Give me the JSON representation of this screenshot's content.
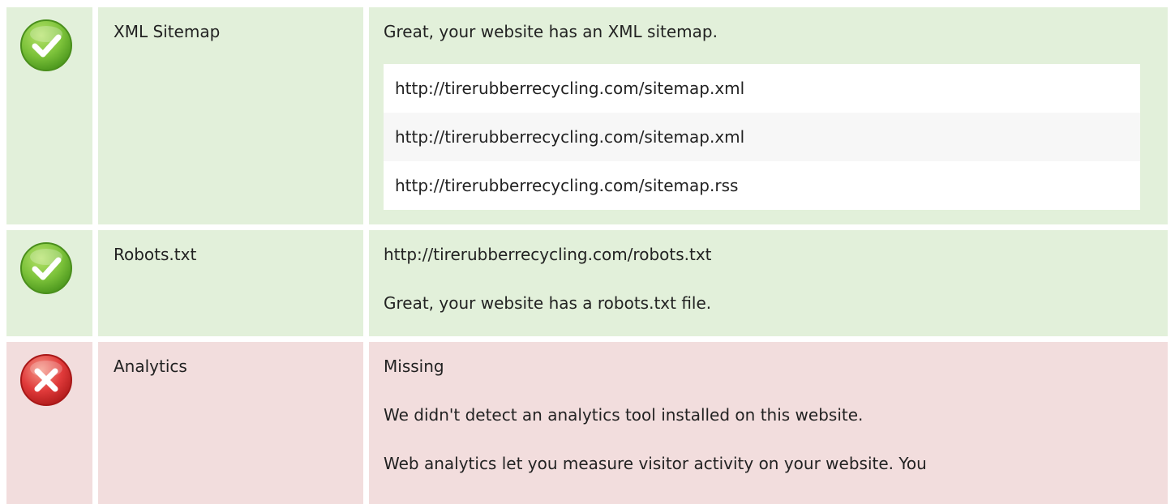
{
  "rows": [
    {
      "status": "pass",
      "name": "XML Sitemap",
      "desc": "Great, your website has an XML sitemap.",
      "urls": [
        "http://tirerubberrecycling.com/sitemap.xml",
        "http://tirerubberrecycling.com/sitemap.xml",
        "http://tirerubberrecycling.com/sitemap.rss"
      ]
    },
    {
      "status": "pass",
      "name": "Robots.txt",
      "line1": "http://tirerubberrecycling.com/robots.txt",
      "line2": "Great, your website has a robots.txt file."
    },
    {
      "status": "fail",
      "name": "Analytics",
      "line1": "Missing",
      "line2": "We didn't detect an analytics tool installed on this website.",
      "line3": "Web analytics let you measure visitor activity on your website. You"
    }
  ],
  "colors": {
    "pass_bg": "#e2f0da",
    "fail_bg": "#f2dddd",
    "pass_icon": "#7cc23a",
    "fail_icon": "#e03a3a"
  },
  "icons": {
    "pass": "check-circle-icon",
    "fail": "x-circle-icon"
  }
}
